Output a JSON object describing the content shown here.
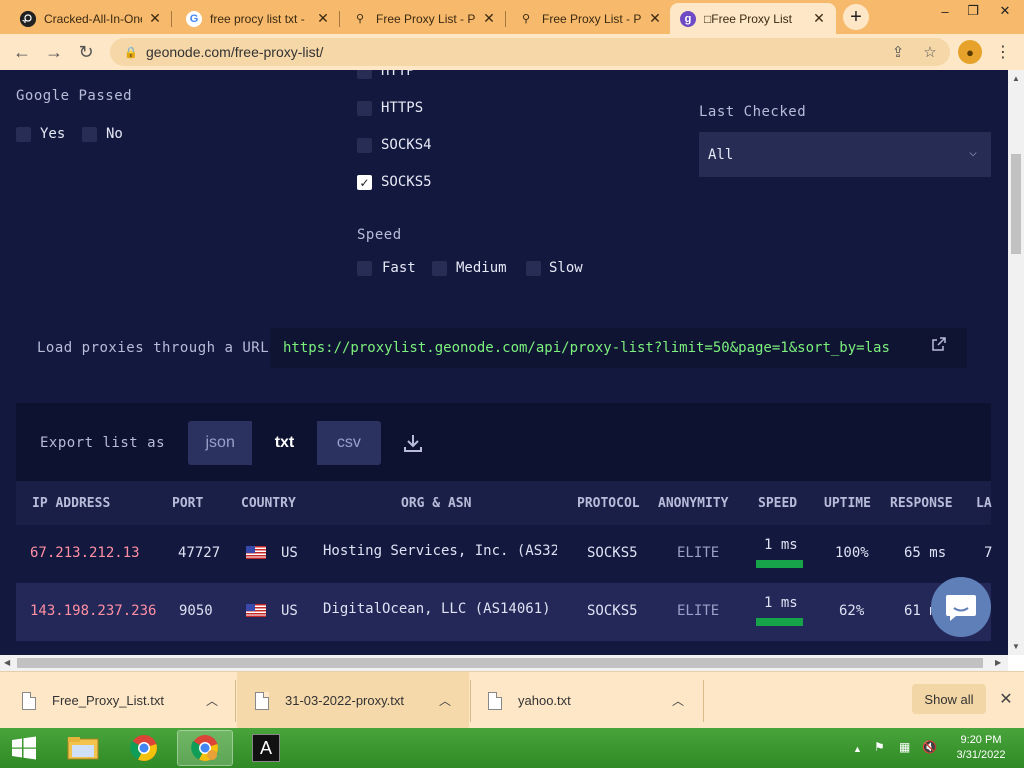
{
  "browser": {
    "tabs": [
      {
        "title": "Cracked-All-In-One",
        "icon": "github-icon",
        "active": false
      },
      {
        "title": "free procy list txt -",
        "icon": "google-icon",
        "active": false
      },
      {
        "title": "Free Proxy List - Pr",
        "icon": "proxy-site-icon",
        "active": false
      },
      {
        "title": "Free Proxy List - Pr",
        "icon": "proxy-site-icon",
        "active": false
      },
      {
        "title": "□Free Proxy List",
        "icon": "geonode-icon",
        "active": true
      }
    ],
    "new_tab_label": "+",
    "window_controls": {
      "minimize": "–",
      "restore": "❐",
      "close": "✕"
    },
    "url": "geonode.com/free-proxy-list/",
    "profile_initial": "●"
  },
  "filters": {
    "google_passed_label": "Google Passed",
    "google_options": [
      {
        "label": "Yes",
        "checked": false
      },
      {
        "label": "No",
        "checked": false
      }
    ],
    "protocols": [
      {
        "label": "HTTP",
        "checked": false
      },
      {
        "label": "HTTPS",
        "checked": false
      },
      {
        "label": "SOCKS4",
        "checked": false
      },
      {
        "label": "SOCKS5",
        "checked": true
      }
    ],
    "speed_label": "Speed",
    "speed_options": [
      {
        "label": "Fast",
        "checked": false
      },
      {
        "label": "Medium",
        "checked": false
      },
      {
        "label": "Slow",
        "checked": false
      }
    ],
    "last_checked_label": "Last Checked",
    "last_checked_value": "All"
  },
  "url_loader": {
    "label": "Load proxies through a URL",
    "url": "https://proxylist.geonode.com/api/proxy-list?limit=50&page=1&sort_by=las"
  },
  "export": {
    "label": "Export list as",
    "formats": [
      {
        "label": "json",
        "active": false
      },
      {
        "label": "txt",
        "active": true
      },
      {
        "label": "csv",
        "active": false
      }
    ]
  },
  "table": {
    "columns": [
      "IP ADDRESS",
      "PORT",
      "COUNTRY",
      "ORG & ASN",
      "PROTOCOL",
      "ANONYMITY",
      "SPEED",
      "UPTIME",
      "RESPONSE",
      "LA"
    ],
    "rows": [
      {
        "ip": "67.213.212.13",
        "port": "47727",
        "country": "US",
        "org": "Hosting Services, Inc. (AS32",
        "protocol": "SOCKS5",
        "anonymity": "ELITE",
        "speed": "1 ms",
        "speed_level": 1.0,
        "uptime": "100%",
        "response": "65 ms",
        "last": "7"
      },
      {
        "ip": "143.198.237.236",
        "port": "9050",
        "country": "US",
        "org": "DigitalOcean, LLC (AS14061)",
        "protocol": "SOCKS5",
        "anonymity": "ELITE",
        "speed": "1 ms",
        "speed_level": 1.0,
        "uptime": "62%",
        "response": "61 m",
        "last": ""
      }
    ]
  },
  "downloads": {
    "items": [
      {
        "name": "Free_Proxy_List.txt"
      },
      {
        "name": "31-03-2022-proxy.txt"
      },
      {
        "name": "yahoo.txt"
      }
    ],
    "show_all": "Show all",
    "close": "✕"
  },
  "taskbar": {
    "time": "9:20 PM",
    "date": "3/31/2022"
  },
  "colors": {
    "page_bg": "#13183f",
    "accent_green": "#7cf07c",
    "ip_pink": "#ff8fa3",
    "speed_bar": "#16a34a"
  }
}
